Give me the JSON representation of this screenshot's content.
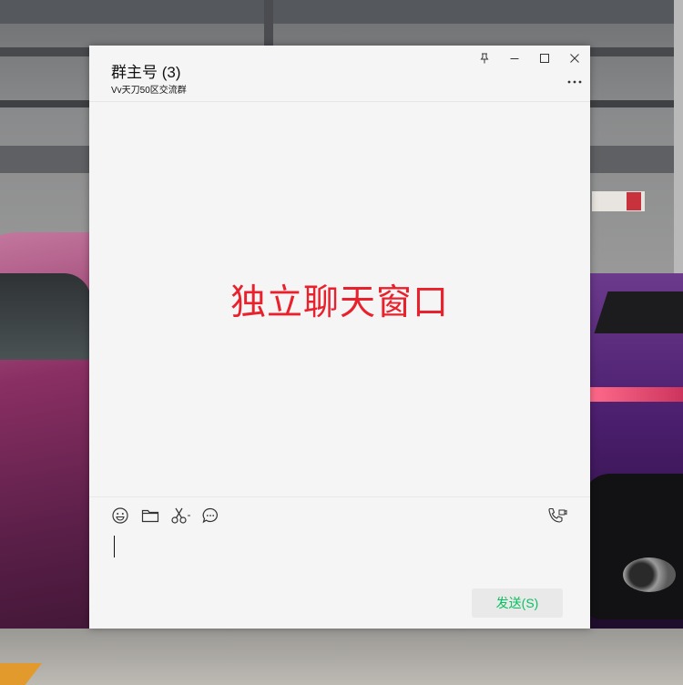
{
  "window": {
    "title": "群主号 (3)",
    "subtitle": "Vv天刀50区交流群",
    "controls": [
      "pin-icon",
      "minimize-icon",
      "maximize-icon",
      "close-icon"
    ],
    "more_icon": "more-dots-icon"
  },
  "messages": {
    "center_text": "独立聊天窗口",
    "center_text_color": "#e8212c"
  },
  "toolbar": {
    "tools": [
      "emoji-icon",
      "folder-icon",
      "scissors-icon",
      "chat-bubble-icon"
    ],
    "right_tool": "video-call-icon"
  },
  "composer": {
    "value": "",
    "send_label": "发送(S)",
    "send_color": "#07c160"
  }
}
